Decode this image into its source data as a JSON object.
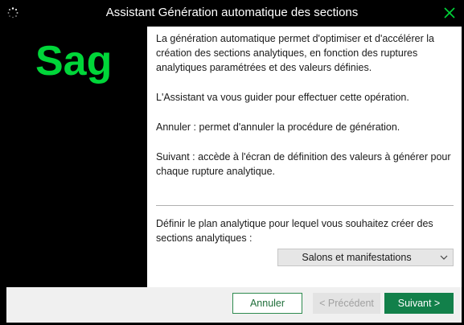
{
  "window": {
    "title": "Assistant Génération automatique des sections"
  },
  "logo": {
    "text": "Sage",
    "color": "#00d639"
  },
  "content": {
    "paragraphs": [
      "La génération automatique permet d'optimiser et d'accélérer la création des sections analytiques, en fonction des ruptures analytiques paramétrées et des valeurs définies.",
      "L'Assistant va vous guider pour effectuer cette opération.",
      "Annuler : permet d'annuler la procédure de génération.",
      "Suivant : accède à l'écran de définition des valeurs à générer pour chaque rupture analytique."
    ],
    "select_label": "Définir le plan analytique pour lequel vous souhaitez créer des sections analytiques :",
    "select_value": "Salons et manifestations"
  },
  "buttons": {
    "cancel": "Annuler",
    "previous": "< Précédent",
    "next": "Suivant >"
  },
  "icons": {
    "title": "spinner-icon",
    "close": "close-icon",
    "dropdown": "chevron-down-icon"
  },
  "colors": {
    "accent": "#12804a",
    "logo": "#00d639",
    "window_frame": "#000000"
  }
}
